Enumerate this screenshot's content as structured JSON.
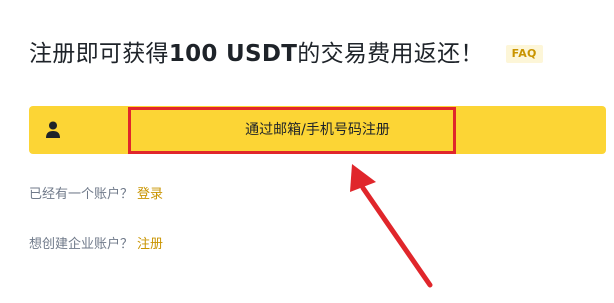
{
  "headline": {
    "prefix": "注册即可获得",
    "amount": "100 USDT",
    "suffix": "的交易费用返还！",
    "faq": "FAQ"
  },
  "signup": {
    "icon": "user-icon",
    "label": "通过邮箱/手机号码注册"
  },
  "login_prompt": {
    "text": "已经有一个账户？",
    "link": "登录"
  },
  "corporate_prompt": {
    "text": "想创建企业账户？",
    "link": "注册"
  },
  "annotation": {
    "highlight_color": "#e0262b",
    "arrow_color": "#e0262b"
  },
  "colors": {
    "brand_yellow": "#fcd535",
    "link_gold": "#c99400",
    "text_dark": "#1e2329",
    "text_muted": "#707a8a"
  }
}
